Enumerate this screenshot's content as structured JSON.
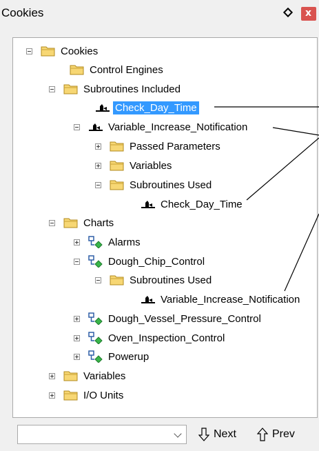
{
  "window": {
    "title": "Cookies",
    "close_glyph": "x"
  },
  "tree": [
    {
      "label": "Cookies",
      "icon": "folder-icon",
      "expander": "minus"
    },
    {
      "label": "Control Engines",
      "icon": "folder-icon",
      "expander": "none"
    },
    {
      "label": "Subroutines Included",
      "icon": "folder-icon",
      "expander": "minus"
    },
    {
      "label": "Check_Day_Time",
      "icon": "subroutine-icon",
      "expander": "none",
      "selected": true
    },
    {
      "label": "Variable_Increase_Notification",
      "icon": "subroutine-icon",
      "expander": "minus"
    },
    {
      "label": "Passed Parameters",
      "icon": "folder-icon",
      "expander": "plus"
    },
    {
      "label": "Variables",
      "icon": "folder-icon",
      "expander": "plus"
    },
    {
      "label": "Subroutines Used",
      "icon": "folder-icon",
      "expander": "minus"
    },
    {
      "label": "Check_Day_Time",
      "icon": "subroutine-icon",
      "expander": "none"
    },
    {
      "label": "Charts",
      "icon": "folder-icon",
      "expander": "minus"
    },
    {
      "label": "Alarms",
      "icon": "chart-icon",
      "expander": "plus"
    },
    {
      "label": "Dough_Chip_Control",
      "icon": "chart-icon",
      "expander": "minus"
    },
    {
      "label": "Subroutines Used",
      "icon": "folder-icon",
      "expander": "minus"
    },
    {
      "label": "Variable_Increase_Notification",
      "icon": "subroutine-icon",
      "expander": "none"
    },
    {
      "label": "Dough_Vessel_Pressure_Control",
      "icon": "chart-icon",
      "expander": "plus"
    },
    {
      "label": "Oven_Inspection_Control",
      "icon": "chart-icon",
      "expander": "plus"
    },
    {
      "label": "Powerup",
      "icon": "chart-icon",
      "expander": "plus"
    },
    {
      "label": "Variables",
      "icon": "folder-icon",
      "expander": "plus"
    },
    {
      "label": "I/O Units",
      "icon": "folder-icon",
      "expander": "plus"
    }
  ],
  "search": {
    "value": ""
  },
  "nav": {
    "next_label": "Next",
    "prev_label": "Prev"
  },
  "colors": {
    "selection": "#3399ff",
    "folder_fill": "#f7d774",
    "chart_icon_blue": "#2f5fa7",
    "chart_icon_green": "#39b54a",
    "close_button": "#d9534f"
  }
}
